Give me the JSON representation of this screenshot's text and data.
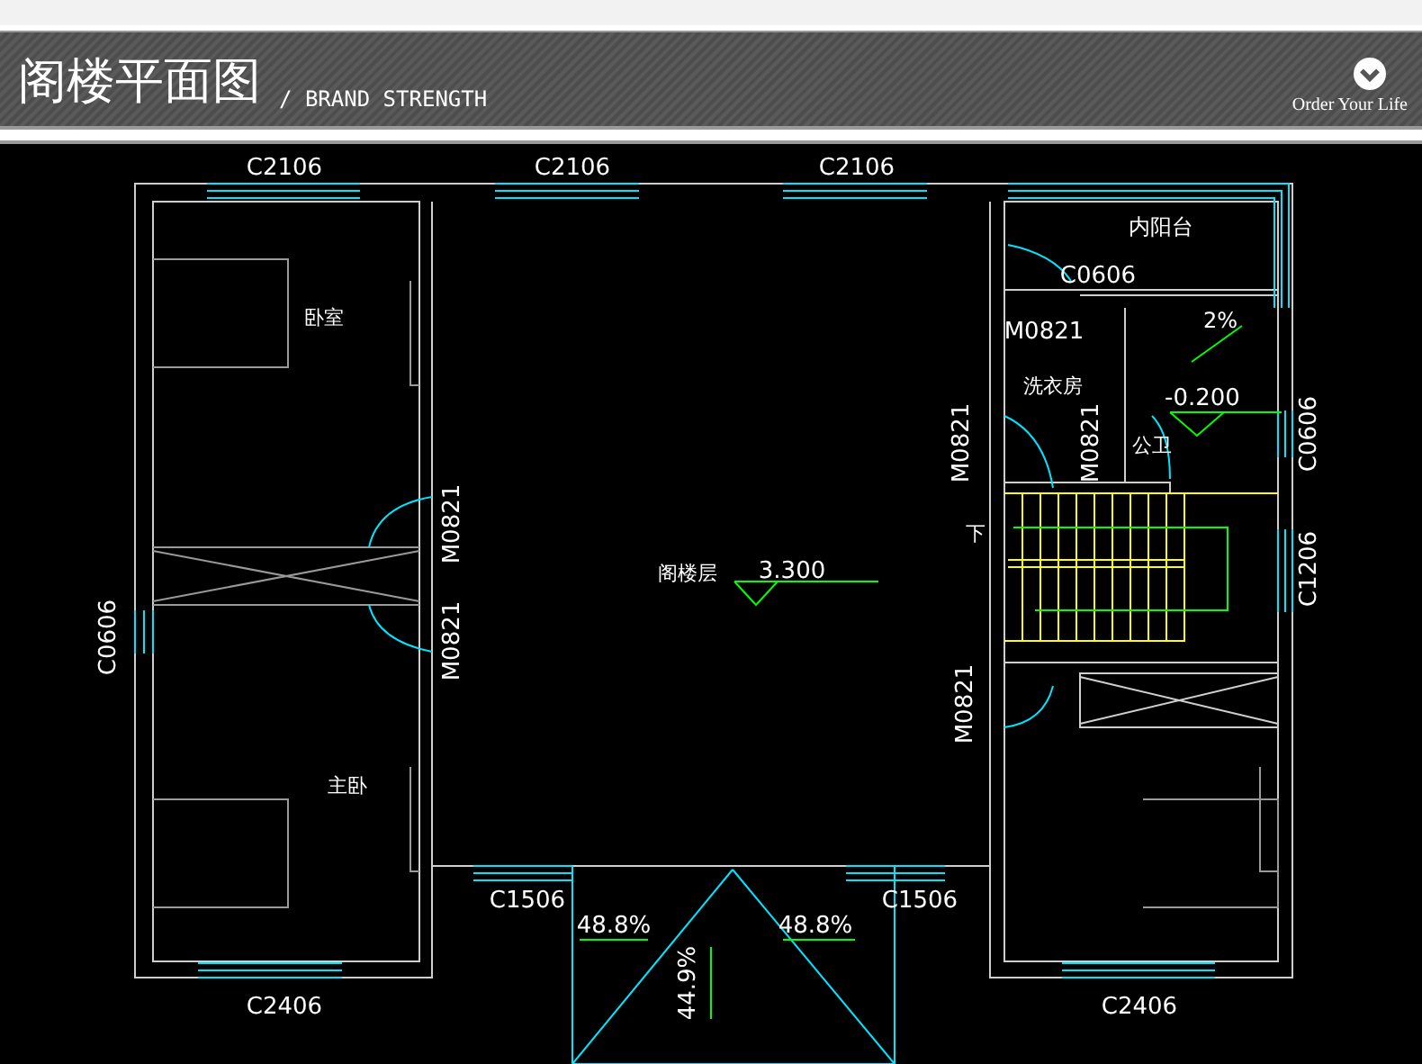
{
  "header": {
    "title": "阁楼平面图",
    "subtitle": "/ BRAND STRENGTH",
    "tagline": "Order Your Life"
  },
  "plan": {
    "labels": [
      "C2106",
      "C2106",
      "C2106",
      "内阳台",
      "C0606",
      "卧室",
      "M0821",
      "2%",
      "洗衣房",
      "-0.200",
      "M0821",
      "M0821",
      "公卫",
      "C0606",
      "M0821",
      "下",
      "阁楼层",
      "3.300",
      "C1206",
      "C0606",
      "M0821",
      "M0821",
      "主卧",
      "C1506",
      "C1506",
      "48.8%",
      "48.8%",
      "44.9%",
      "C2406",
      "C2406"
    ]
  }
}
